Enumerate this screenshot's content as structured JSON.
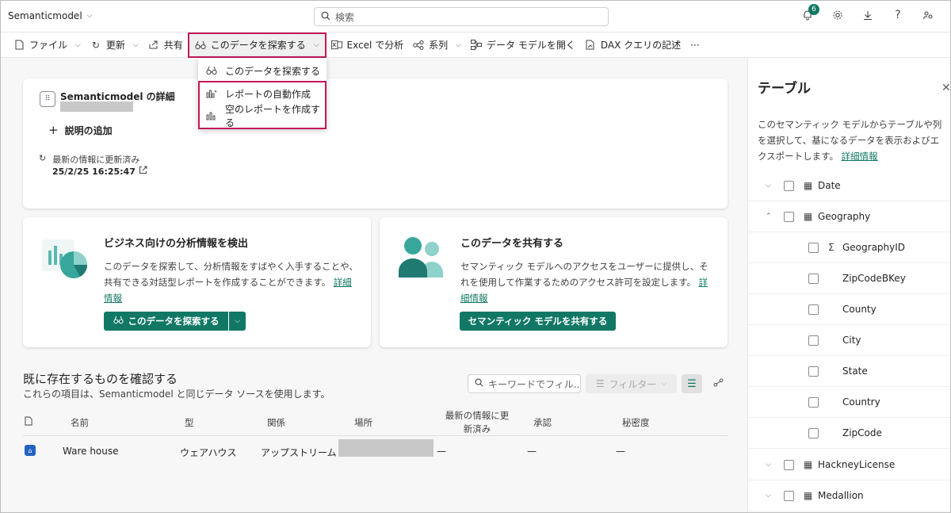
{
  "header": {
    "app_title": "Semanticmodel",
    "search_placeholder": "検索",
    "notification_count": "6"
  },
  "toolbar": {
    "file": "ファイル",
    "refresh": "更新",
    "share": "共有",
    "explore": "このデータを探索する",
    "excel": "Excel で分析",
    "lineage": "系列",
    "open_model": "データ モデルを開く",
    "dax": "DAX クエリの記述",
    "more": "···"
  },
  "dropdown": {
    "items": [
      {
        "label": "このデータを探索する"
      },
      {
        "label": "レポートの自動作成"
      },
      {
        "label": "空のレポートを作成する"
      }
    ]
  },
  "details": {
    "title": "Semanticmodel の詳細",
    "add_description": "説明の追加",
    "refresh_label": "最新の情報に更新済み",
    "refresh_date": "25/2/25 16:25:47"
  },
  "insight_card": {
    "title": "ビジネス向けの分析情報を検出",
    "body": "このデータを探索して、分析情報をすばやく入手することや、共有できる対話型レポートを作成することができます。",
    "link": "詳細情報",
    "button": "このデータを探索する"
  },
  "share_card": {
    "title": "このデータを共有する",
    "body": "セマンティック モデルへのアクセスをユーザーに提供し、それを使用して作業するためのアクセス許可を設定します。",
    "link": "詳細情報",
    "button": "セマンティック モデルを共有する"
  },
  "existing": {
    "title": "既に存在するものを確認する",
    "subtitle": "これらの項目は、Semanticmodel と同じデータ ソースを使用します。",
    "filter_placeholder": "キーワードでフィル...",
    "filter_button": "フィルター",
    "columns": {
      "name": "名前",
      "type": "型",
      "relation": "関係",
      "location": "場所",
      "refreshed_line1": "最新の情報に更",
      "refreshed_line2": "新済み",
      "endorsement": "承認",
      "sensitivity": "秘密度"
    },
    "rows": [
      {
        "name": "Ware house",
        "type": "ウェアハウス",
        "relation": "アップストリーム",
        "refreshed": "—",
        "endorsement": "—",
        "sensitivity": "—"
      }
    ]
  },
  "side_panel": {
    "title": "テーブル",
    "description": "このセマンティック モデルからテーブルや列を選択して、基になるデータを表示およびエクスポートします。",
    "link": "詳細情報",
    "tree": [
      {
        "label": "Date",
        "level": 0,
        "expanded": false,
        "kind": "table"
      },
      {
        "label": "Geography",
        "level": 0,
        "expanded": true,
        "kind": "table"
      },
      {
        "label": "GeographyID",
        "level": 1,
        "kind": "measure"
      },
      {
        "label": "ZipCodeBKey",
        "level": 1,
        "kind": "column"
      },
      {
        "label": "County",
        "level": 1,
        "kind": "column"
      },
      {
        "label": "City",
        "level": 1,
        "kind": "column"
      },
      {
        "label": "State",
        "level": 1,
        "kind": "column"
      },
      {
        "label": "Country",
        "level": 1,
        "kind": "column"
      },
      {
        "label": "ZipCode",
        "level": 1,
        "kind": "column"
      },
      {
        "label": "HackneyLicense",
        "level": 0,
        "expanded": false,
        "kind": "table"
      },
      {
        "label": "Medallion",
        "level": 0,
        "expanded": false,
        "kind": "table"
      }
    ]
  },
  "colors": {
    "accent": "#117865",
    "highlight": "#c3185b"
  }
}
